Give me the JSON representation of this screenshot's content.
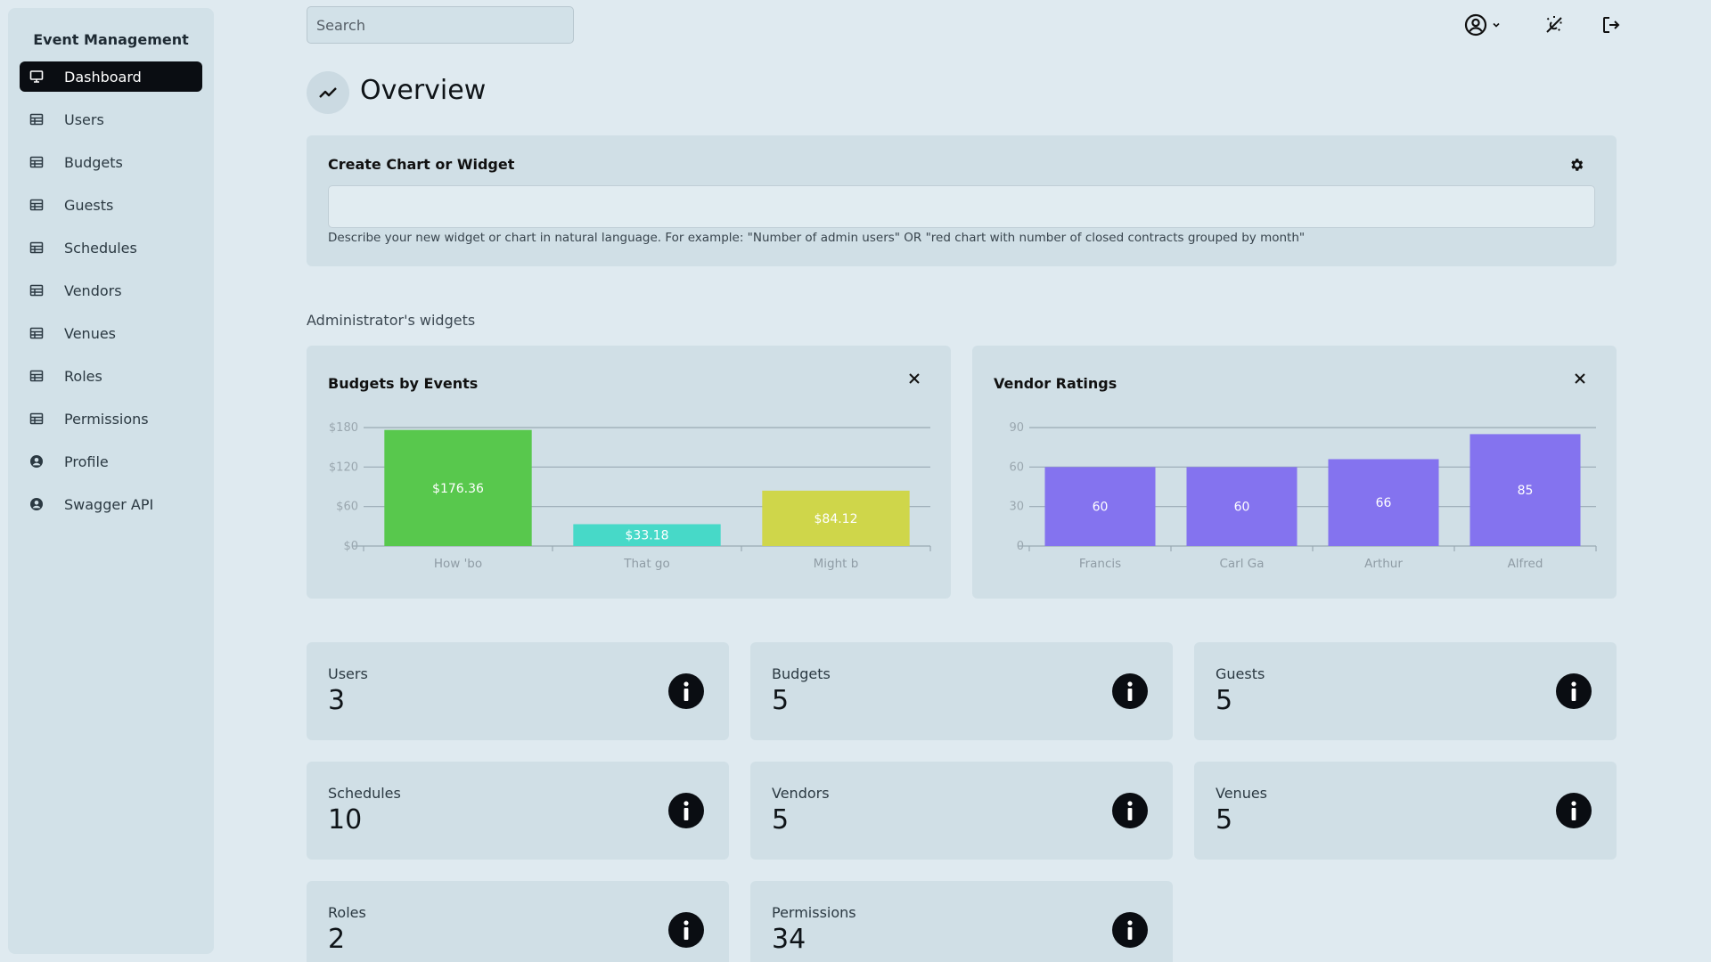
{
  "app": {
    "title": "Event Management"
  },
  "sidebar": {
    "items": [
      {
        "label": "Dashboard",
        "icon": "monitor-icon",
        "active": true
      },
      {
        "label": "Users",
        "icon": "table-icon"
      },
      {
        "label": "Budgets",
        "icon": "table-icon"
      },
      {
        "label": "Guests",
        "icon": "table-icon"
      },
      {
        "label": "Schedules",
        "icon": "table-icon"
      },
      {
        "label": "Vendors",
        "icon": "table-icon"
      },
      {
        "label": "Venues",
        "icon": "table-icon"
      },
      {
        "label": "Roles",
        "icon": "table-icon"
      },
      {
        "label": "Permissions",
        "icon": "table-icon"
      },
      {
        "label": "Profile",
        "icon": "user-circle-icon"
      },
      {
        "label": "Swagger API",
        "icon": "user-circle-icon"
      }
    ]
  },
  "topbar": {
    "search_placeholder": "Search",
    "icons": [
      "user-menu-icon",
      "theme-toggle-icon",
      "logout-icon"
    ]
  },
  "page": {
    "title": "Overview"
  },
  "create_widget": {
    "title": "Create Chart or Widget",
    "hint": "Describe your new widget or chart in natural language. For example: \"Number of admin users\" OR \"red chart with number of closed contracts grouped by month\""
  },
  "widgets_section": {
    "label": "Administrator's widgets"
  },
  "colors": {
    "accent": "#0a0d12",
    "background": "#dfeaf0",
    "panel": "#d0dfe6"
  },
  "chart_data": [
    {
      "type": "bar",
      "title": "Budgets by Events",
      "categories": [
        "How 'bo",
        "That go",
        "Might b"
      ],
      "values": [
        176.36,
        33.18,
        84.12
      ],
      "value_labels": [
        "$176.36",
        "$33.18",
        "$84.12"
      ],
      "colors": [
        "#58c84d",
        "#47d9c8",
        "#cfd64a"
      ],
      "yticks": [
        0,
        60,
        120,
        180
      ],
      "ytick_labels": [
        "$0",
        "$60",
        "$120",
        "$180"
      ],
      "ylim": [
        0,
        180
      ],
      "grid": true
    },
    {
      "type": "bar",
      "title": "Vendor Ratings",
      "categories": [
        "Francis",
        "Carl Ga",
        "Arthur",
        "Alfred"
      ],
      "values": [
        60,
        60,
        66,
        85
      ],
      "value_labels": [
        "60",
        "60",
        "66",
        "85"
      ],
      "colors": [
        "#8473ef",
        "#8473ef",
        "#8473ef",
        "#8473ef"
      ],
      "yticks": [
        0,
        30,
        60,
        90
      ],
      "ytick_labels": [
        "0",
        "30",
        "60",
        "90"
      ],
      "ylim": [
        0,
        90
      ],
      "grid": true
    }
  ],
  "stats": [
    {
      "label": "Users",
      "value": "3"
    },
    {
      "label": "Budgets",
      "value": "5"
    },
    {
      "label": "Guests",
      "value": "5"
    },
    {
      "label": "Schedules",
      "value": "10"
    },
    {
      "label": "Vendors",
      "value": "5"
    },
    {
      "label": "Venues",
      "value": "5"
    },
    {
      "label": "Roles",
      "value": "2"
    },
    {
      "label": "Permissions",
      "value": "34"
    }
  ]
}
